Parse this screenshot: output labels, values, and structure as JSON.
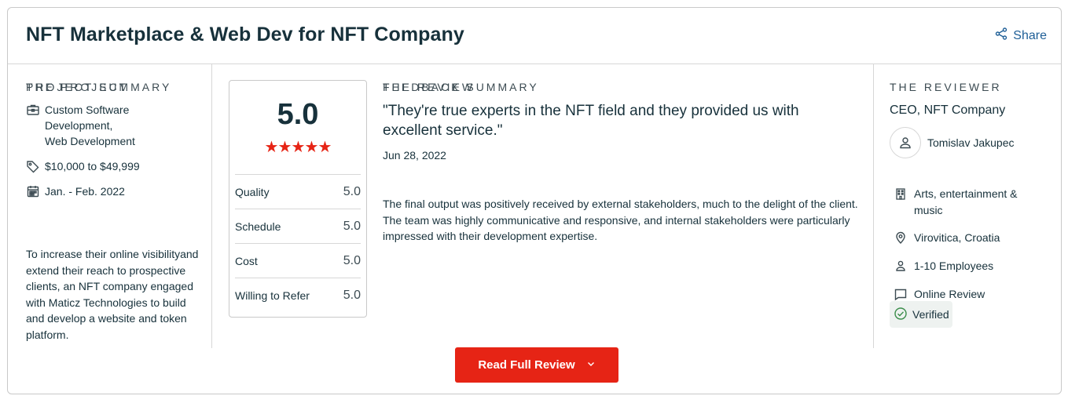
{
  "header": {
    "title": "NFT Marketplace & Web Dev for NFT Company",
    "share_label": "Share"
  },
  "project": {
    "section_label": "THE PROJECT",
    "services": [
      "Custom Software",
      "Development,",
      "Web Development"
    ],
    "budget": "$10,000 to $49,999",
    "timeline": "Jan. - Feb. 2022",
    "summary_label": "PROJECT SUMMARY",
    "summary": "To increase their online visibilityand extend their reach to prospective clients, an NFT company engaged with Maticz Technologies to build and develop a website and token platform."
  },
  "rating": {
    "overall": "5.0",
    "stars": 5,
    "scores": [
      {
        "label": "Quality",
        "value": "5.0"
      },
      {
        "label": "Schedule",
        "value": "5.0"
      },
      {
        "label": "Cost",
        "value": "5.0"
      },
      {
        "label": "Willing to Refer",
        "value": "5.0"
      }
    ]
  },
  "review": {
    "section_label": "THE REVIEW",
    "quote": "\"They're true experts in the NFT field and they provided us with excellent service.\"",
    "date": "Jun 28, 2022",
    "feedback_label": "FEEDBACK SUMMARY",
    "feedback": "The final output was positively received by external stakeholders, much to the delight of the client. The team was highly communicative and responsive, and internal stakeholders were particularly impressed with their development expertise."
  },
  "reviewer": {
    "section_label": "THE REVIEWER",
    "role": "CEO, NFT Company",
    "name": "Tomislav Jakupec",
    "industry": "Arts, entertainment & music",
    "location": "Virovitica, Croatia",
    "size": "1-10 Employees",
    "review_type": "Online Review",
    "verified_label": "Verified"
  },
  "actions": {
    "read_full_review": "Read Full Review"
  },
  "colors": {
    "accent_red": "#e62415",
    "link_blue": "#1f5f97",
    "text_dark": "#17313b"
  }
}
